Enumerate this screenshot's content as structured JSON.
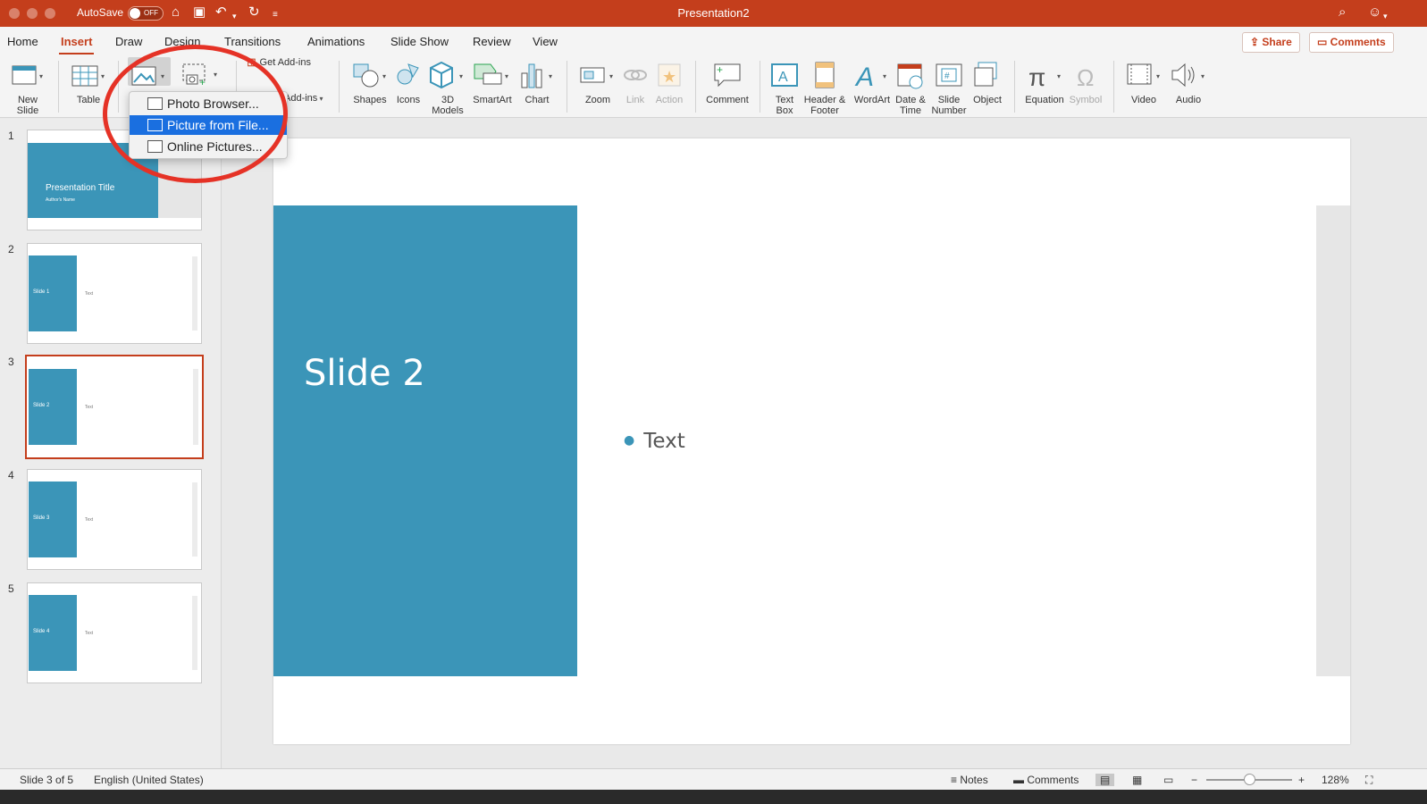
{
  "titlebar": {
    "autosave_label": "AutoSave",
    "autosave_state": "OFF",
    "document_title": "Presentation2"
  },
  "tabs": [
    "Home",
    "Insert",
    "Draw",
    "Design",
    "Transitions",
    "Animations",
    "Slide Show",
    "Review",
    "View"
  ],
  "active_tab": "Insert",
  "share_label": "Share",
  "comments_label": "Comments",
  "ribbon": {
    "new_slide": "New\nSlide",
    "table": "Table",
    "get_addins": "Get Add-ins",
    "my_addins": "Add-ins",
    "shapes": "Shapes",
    "icons": "Icons",
    "models": "3D\nModels",
    "smartart": "SmartArt",
    "chart": "Chart",
    "zoom": "Zoom",
    "link": "Link",
    "action": "Action",
    "comment": "Comment",
    "textbox": "Text\nBox",
    "header_footer": "Header &\nFooter",
    "wordart": "WordArt",
    "datetime": "Date &\nTime",
    "slide_number": "Slide\nNumber",
    "object": "Object",
    "equation": "Equation",
    "symbol": "Symbol",
    "video": "Video",
    "audio": "Audio"
  },
  "picture_menu": {
    "items": [
      "Photo Browser...",
      "Picture from File...",
      "Online Pictures..."
    ],
    "highlighted": "Picture from File..."
  },
  "thumbnails": [
    {
      "number": "1",
      "title": "Presentation Title",
      "subtitle": "Author's Name"
    },
    {
      "number": "2",
      "title": "Slide 1",
      "text": "Text"
    },
    {
      "number": "3",
      "title": "Slide 2",
      "text": "Text"
    },
    {
      "number": "4",
      "title": "Slide 3",
      "text": "Text"
    },
    {
      "number": "5",
      "title": "Slide 4",
      "text": "Text"
    }
  ],
  "selected_slide": "3",
  "slide": {
    "title": "Slide 2",
    "bullet": "Text"
  },
  "status": {
    "slide_count": "Slide 3 of 5",
    "language": "English (United States)",
    "notes": "Notes",
    "comments": "Comments",
    "zoom": "128%",
    "zoom_level": 0.5
  },
  "colors": {
    "accent": "#c43e1c",
    "slide_block": "#3b95b8",
    "menu_highlight": "#1a6fe0",
    "annotation_ring": "#e53226"
  }
}
